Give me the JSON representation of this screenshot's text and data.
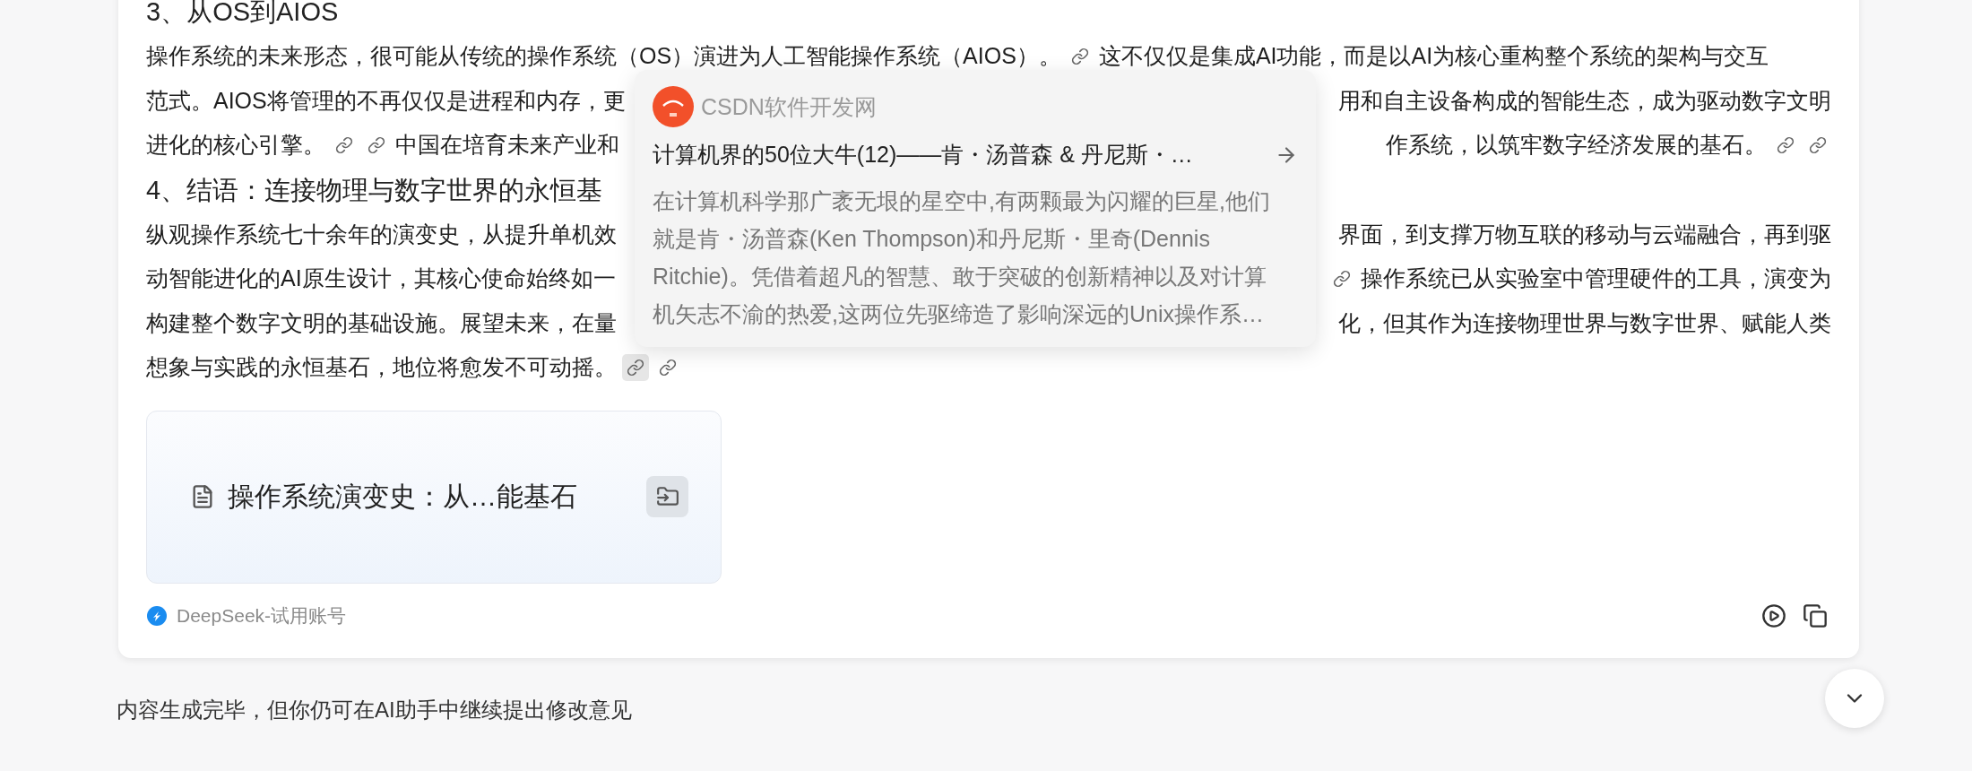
{
  "article": {
    "sections": [
      {
        "heading": "3、从OS到AIOS",
        "lines": [
          {
            "left": [
              {
                "kind": "text",
                "text": "操作系统的未来形态，很可能从传统的操作系统（OS）演进为人工智能操作系统（AIOS）。"
              },
              {
                "kind": "link",
                "hovered": false
              },
              {
                "kind": "text",
                "text": "这不仅仅是集成AI功能，而是以AI为核心重构整个系统的架构与交互"
              }
            ]
          },
          {
            "left": [
              {
                "kind": "text",
                "text": "范式。AIOS将管理的不再仅仅是进程和内存，更"
              }
            ],
            "right": [
              {
                "kind": "text",
                "text": "用和自主设备构成的智能生态，成为驱动数字文明"
              }
            ]
          },
          {
            "left": [
              {
                "kind": "text",
                "text": "进化的核心引擎。"
              },
              {
                "kind": "link",
                "hovered": false
              },
              {
                "kind": "link",
                "hovered": false
              },
              {
                "kind": "text",
                "text": "中国在培育未来产业和"
              }
            ],
            "right": [
              {
                "kind": "text",
                "text": "作系统，以筑牢数字经济发展的基石。"
              },
              {
                "kind": "link",
                "hovered": false
              },
              {
                "kind": "link",
                "hovered": false
              }
            ]
          }
        ]
      },
      {
        "heading": "4、结语：连接物理与数字世界的永恒基",
        "lines": [
          {
            "left": [
              {
                "kind": "text",
                "text": "纵观操作系统七十余年的演变史，从提升单机效"
              }
            ],
            "right": [
              {
                "kind": "text",
                "text": "界面，到支撑万物互联的移动与云端融合，再到驱"
              }
            ]
          },
          {
            "left": [
              {
                "kind": "text",
                "text": "动智能进化的AI原生设计，其核心使命始终如一"
              }
            ],
            "right": [
              {
                "kind": "link",
                "hovered": false
              },
              {
                "kind": "text",
                "text": "操作系统已从实验室中管理硬件的工具，演变为"
              }
            ]
          },
          {
            "left": [
              {
                "kind": "text",
                "text": "构建整个数字文明的基础设施。展望未来，在量"
              }
            ],
            "right": [
              {
                "kind": "text",
                "text": "化，但其作为连接物理世界与数字世界、赋能人类"
              }
            ]
          },
          {
            "left": [
              {
                "kind": "text",
                "text": "想象与实践的永恒基石，地位将愈发不可动摇。"
              },
              {
                "kind": "link",
                "hovered": true
              },
              {
                "kind": "link",
                "hovered": false
              }
            ]
          }
        ]
      }
    ]
  },
  "popup": {
    "source": "CSDN软件开发网",
    "title": "计算机界的50位大牛(12)——肯・汤普森 & 丹尼斯・…",
    "description": "在计算机科学那广袤无垠的星空中,有两颗最为闪耀的巨星,他们就是肯・汤普森(Ken Thompson)和丹尼斯・里奇(Dennis Ritchie)。凭借着超凡的智慧、敢于突破的创新精神以及对计算机矢志不渝的热爱,这两位先驱缔造了影响深远的Unix操作系…"
  },
  "document": {
    "title": "操作系统演变史：从…能基石"
  },
  "footer": {
    "model": "DeepSeek-试用账号"
  },
  "status": "内容生成完毕，但你仍可在AI助手中继续提出修改意见"
}
